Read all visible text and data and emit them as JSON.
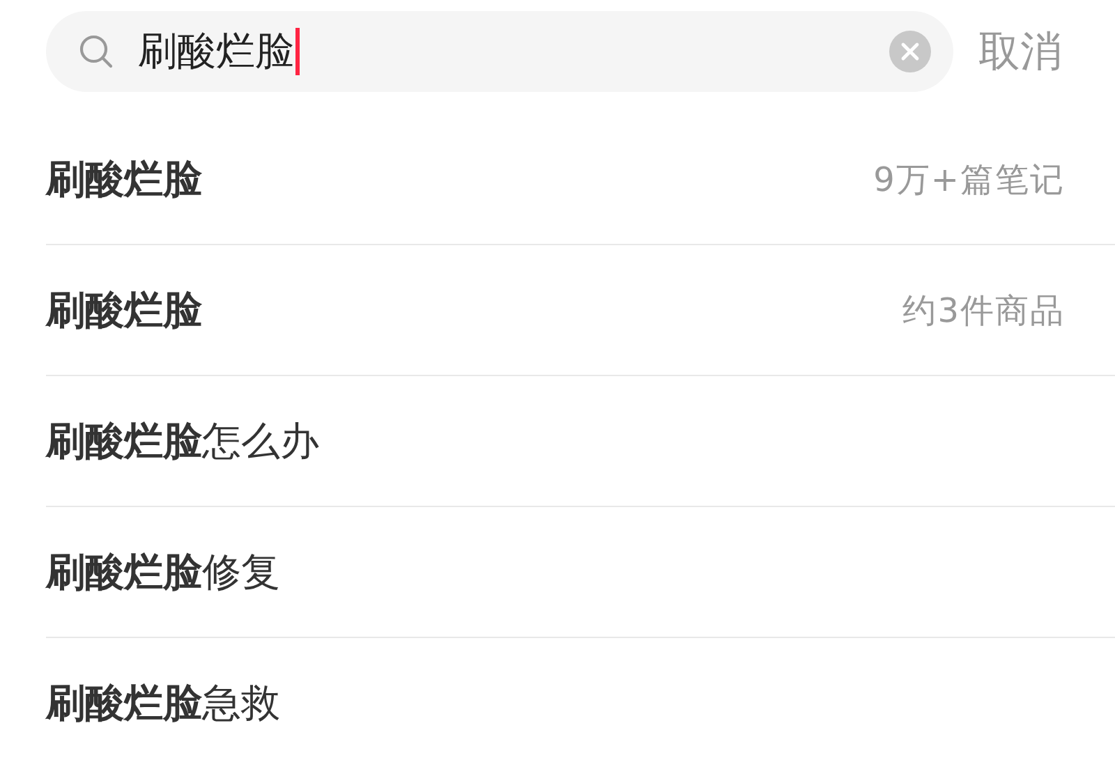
{
  "search": {
    "value": "刷酸烂脸",
    "cancel": "取消"
  },
  "suggestions": [
    {
      "text": "**刷酸烂脸**",
      "meta": "9万+篇笔记"
    },
    {
      "text": "**刷酸烂脸**",
      "meta": "约3件商品"
    },
    {
      "text": "**刷酸烂脸**怎么办"
    },
    {
      "text": "**刷酸烂脸**修复"
    },
    {
      "text": "**刷酸烂脸**急救"
    }
  ]
}
